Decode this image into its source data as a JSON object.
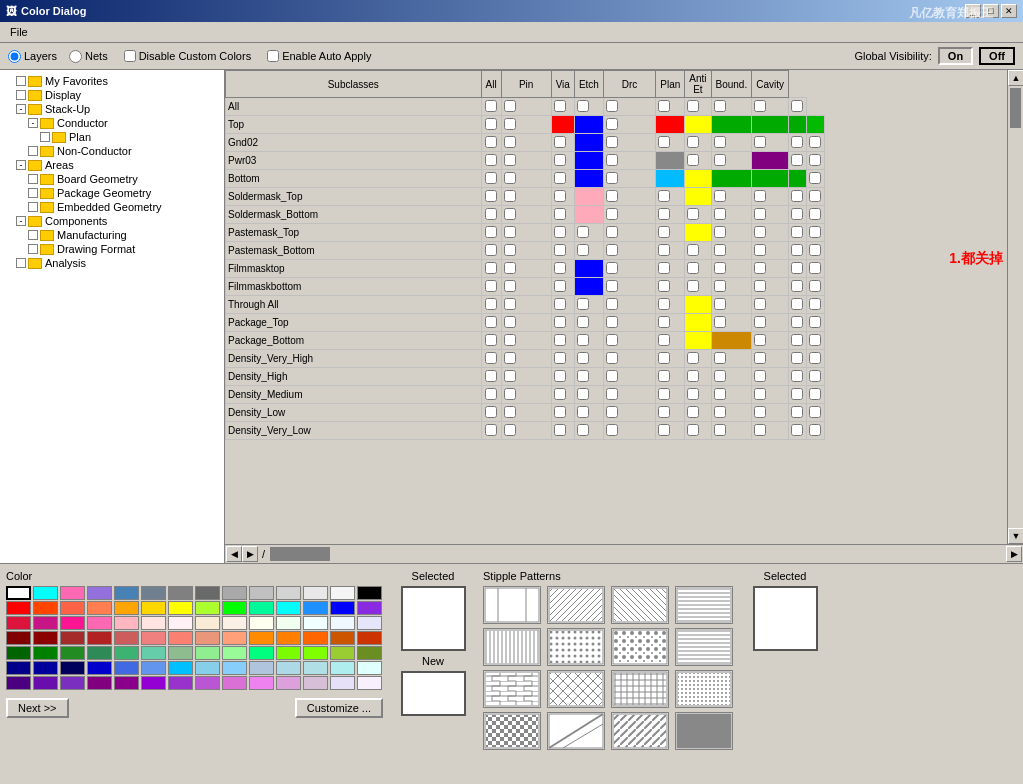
{
  "window": {
    "title": "Color Dialog",
    "watermark": "凡亿教育郑振王"
  },
  "menu": {
    "file": "File"
  },
  "controls": {
    "layers_label": "Layers",
    "nets_label": "Nets",
    "disable_custom": "Disable Custom Colors",
    "enable_auto": "Enable Auto Apply",
    "global_vis": "Global Visibility:",
    "on": "On",
    "off": "Off"
  },
  "tree": {
    "items": [
      {
        "label": "My Favorites",
        "indent": 1,
        "type": "folder"
      },
      {
        "label": "Display",
        "indent": 1,
        "type": "folder"
      },
      {
        "label": "Stack-Up",
        "indent": 1,
        "type": "folder-open",
        "expanded": true
      },
      {
        "label": "Conductor",
        "indent": 2,
        "type": "folder-open",
        "expanded": true
      },
      {
        "label": "Plan",
        "indent": 3,
        "type": "folder"
      },
      {
        "label": "Non-Conductor",
        "indent": 2,
        "type": "folder"
      },
      {
        "label": "Areas",
        "indent": 1,
        "type": "folder-open",
        "expanded": true
      },
      {
        "label": "Board Geometry",
        "indent": 2,
        "type": "folder"
      },
      {
        "label": "Package Geometry",
        "indent": 2,
        "type": "folder"
      },
      {
        "label": "Embedded Geometry",
        "indent": 2,
        "type": "folder"
      },
      {
        "label": "Components",
        "indent": 1,
        "type": "folder-open",
        "expanded": true
      },
      {
        "label": "Manufacturing",
        "indent": 2,
        "type": "folder"
      },
      {
        "label": "Drawing Format",
        "indent": 2,
        "type": "folder"
      },
      {
        "label": "Analysis",
        "indent": 1,
        "type": "folder"
      }
    ]
  },
  "table": {
    "columns": [
      "Subclasses",
      "All",
      "Pin",
      "Via",
      "Etch",
      "Drc",
      "Plan",
      "Anti Et",
      "Bound.",
      "Cavity"
    ],
    "rows": [
      {
        "name": "All",
        "colors": [
          "",
          "",
          "",
          "",
          "",
          "",
          "",
          "",
          "",
          ""
        ]
      },
      {
        "name": "Top",
        "colors": [
          "",
          "red",
          "blue",
          "",
          "red",
          "yellow",
          "green",
          "green",
          "green",
          "green"
        ]
      },
      {
        "name": "Gnd02",
        "colors": [
          "",
          "",
          "blue",
          "",
          "",
          "",
          "",
          "",
          "",
          ""
        ]
      },
      {
        "name": "Pwr03",
        "colors": [
          "",
          "",
          "blue",
          "",
          "gray",
          "",
          "",
          "purple",
          "",
          ""
        ]
      },
      {
        "name": "Bottom",
        "colors": [
          "",
          "",
          "blue",
          "",
          "cyan",
          "yellow",
          "green",
          "green",
          "green",
          ""
        ]
      },
      {
        "name": "Soldermask_Top",
        "colors": [
          "",
          "",
          "pink",
          "",
          "",
          "yellow",
          "",
          "",
          "",
          ""
        ]
      },
      {
        "name": "Soldermask_Bottom",
        "colors": [
          "",
          "",
          "pink",
          "",
          "",
          "",
          "",
          "",
          "",
          ""
        ]
      },
      {
        "name": "Pastemask_Top",
        "colors": [
          "",
          "",
          "",
          "",
          "",
          "yellow",
          "",
          "",
          "",
          ""
        ]
      },
      {
        "name": "Pastemask_Bottom",
        "colors": [
          "",
          "",
          "",
          "",
          "",
          "",
          "",
          "",
          "",
          ""
        ]
      },
      {
        "name": "Filmmasktop",
        "colors": [
          "",
          "",
          "blue",
          "",
          "",
          "",
          "",
          "",
          "",
          ""
        ]
      },
      {
        "name": "Filmmaskbottom",
        "colors": [
          "",
          "",
          "blue",
          "",
          "",
          "",
          "",
          "",
          "",
          ""
        ]
      },
      {
        "name": "Through All",
        "colors": [
          "",
          "",
          "",
          "",
          "",
          "yellow",
          "",
          "",
          "",
          ""
        ]
      },
      {
        "name": "Package_Top",
        "colors": [
          "",
          "",
          "",
          "",
          "",
          "yellow",
          "",
          "",
          "",
          ""
        ]
      },
      {
        "name": "Package_Bottom",
        "colors": [
          "",
          "",
          "",
          "",
          "",
          "yellow",
          "orange",
          "",
          "",
          ""
        ]
      },
      {
        "name": "Density_Very_High",
        "colors": [
          "",
          "",
          "",
          "",
          "",
          "",
          "",
          "",
          "",
          ""
        ]
      },
      {
        "name": "Density_High",
        "colors": [
          "",
          "",
          "",
          "",
          "",
          "",
          "",
          "",
          "",
          ""
        ]
      },
      {
        "name": "Density_Medium",
        "colors": [
          "",
          "",
          "",
          "",
          "",
          "",
          "",
          "",
          "",
          ""
        ]
      },
      {
        "name": "Density_Low",
        "colors": [
          "",
          "",
          "",
          "",
          "",
          "",
          "",
          "",
          "",
          ""
        ]
      },
      {
        "name": "Density_Very_Low",
        "colors": [
          "",
          "",
          "",
          "",
          "",
          "",
          "",
          "",
          "",
          ""
        ]
      }
    ]
  },
  "color_panel": {
    "title": "Color",
    "next_btn": "Next >>",
    "customize_btn": "Customize ...",
    "swatches": [
      "#ffffff",
      "#00ffff",
      "#ff69b4",
      "#9370db",
      "#4682b4",
      "#708090",
      "#808080",
      "#696969",
      "#a9a9a9",
      "#c0c0c0",
      "#d3d3d3",
      "#e8e8e8",
      "#f5f5f5",
      "#000000",
      "#ff0000",
      "#ff4500",
      "#ff6347",
      "#ff7f50",
      "#ffa500",
      "#ffd700",
      "#ffff00",
      "#adff2f",
      "#00ff00",
      "#00fa9a",
      "#00ffff",
      "#1e90ff",
      "#0000ff",
      "#8a2be2",
      "#dc143c",
      "#c71585",
      "#ff1493",
      "#ff69b4",
      "#ffb6c1",
      "#ffe4e1",
      "#fff0f5",
      "#faebd7",
      "#faf0e6",
      "#fffff0",
      "#f0fff0",
      "#f0ffff",
      "#f0f8ff",
      "#e6e6fa",
      "#800000",
      "#8b0000",
      "#a52a2a",
      "#b22222",
      "#cd5c5c",
      "#f08080",
      "#fa8072",
      "#e9967a",
      "#ffa07a",
      "#ff8c00",
      "#ff7f00",
      "#ff6600",
      "#cc5500",
      "#cc3300",
      "#006400",
      "#008000",
      "#228b22",
      "#2e8b57",
      "#3cb371",
      "#66cdaa",
      "#8fbc8f",
      "#90ee90",
      "#98fb98",
      "#00ff7f",
      "#7cfc00",
      "#7fff00",
      "#9acd32",
      "#6b8e23",
      "#00008b",
      "#00009c",
      "#00005c",
      "#0000cd",
      "#4169e1",
      "#6495ed",
      "#00bfff",
      "#87ceeb",
      "#87cefa",
      "#b0c4de",
      "#add8e6",
      "#b0e0e6",
      "#afeeee",
      "#e0ffff",
      "#4b0082",
      "#6a0dad",
      "#7b2fbe",
      "#800080",
      "#8b008b",
      "#9400d3",
      "#9932cc",
      "#ba55d3",
      "#da70d6",
      "#ee82ee",
      "#dda0dd",
      "#d8bfd8",
      "#e6e0f8",
      "#f8f0ff"
    ]
  },
  "selected_panel": {
    "selected_label": "Selected",
    "new_label": "New"
  },
  "stipple": {
    "title": "Stipple Patterns",
    "selected_label": "Selected",
    "patterns": [
      "solid",
      "hlines",
      "diag1",
      "grid",
      "vlines",
      "dots",
      "cross_dots",
      "hlines2",
      "brick",
      "diag2",
      "cross",
      "dots2",
      "chess",
      "diamond",
      "diag3",
      "solid2"
    ]
  },
  "annotation": "1.都关掉"
}
